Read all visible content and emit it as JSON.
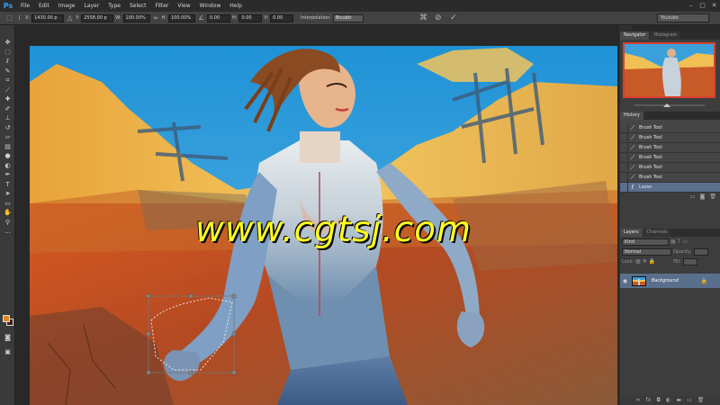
{
  "app": {
    "logo": "Ps",
    "accent": "#2fa3ff"
  },
  "menu": [
    "File",
    "Edit",
    "Image",
    "Layer",
    "Type",
    "Select",
    "Filter",
    "View",
    "Window",
    "Help"
  ],
  "window_controls": {
    "minimize": "–",
    "maximize": "▢",
    "close": "✕"
  },
  "options_bar": {
    "x_label": "X:",
    "x_value": "1430.00 p",
    "y_label": "Y:",
    "y_value": "2558.00 p",
    "w_label": "W:",
    "w_value": "100.00%",
    "h_label": "H:",
    "h_value": "100.00%",
    "angle_value": "0.00",
    "hskew_label": "H:",
    "hskew_value": "0.00",
    "vskew_label": "V:",
    "vskew_value": "0.00",
    "interpolation_label": "Interpolation:",
    "interpolation_value": "Bicubic",
    "workspace": "Youtube"
  },
  "canvas": {
    "watermark": "www.cgtsj.com"
  },
  "navigator": {
    "tabs": [
      "Navigator",
      "Histogram"
    ]
  },
  "history": {
    "tab": "History",
    "items": [
      "Brush Tool",
      "Brush Tool",
      "Brush Tool",
      "Brush Tool",
      "Brush Tool",
      "Brush Tool",
      "Lasso"
    ],
    "active_index": 6
  },
  "layers": {
    "tabs": [
      "Layers",
      "Channels"
    ],
    "filter_kind": "Kind",
    "blend_mode": "Normal",
    "opacity_label": "Opacity:",
    "lock_label": "Lock:",
    "fill_label": "Fill:",
    "layer_name": "Background"
  },
  "colors": {
    "foreground": "#e08a1e",
    "background": "#3a2010",
    "selection": "#5a6f8c",
    "watermark": "#ffff22"
  },
  "icons": [
    "move-icon",
    "marquee-icon",
    "lasso-icon",
    "quick-select-icon",
    "crop-icon",
    "eyedropper-icon",
    "healing-icon",
    "brush-icon",
    "stamp-icon",
    "history-brush-icon",
    "eraser-icon",
    "gradient-icon",
    "blur-icon",
    "dodge-icon",
    "pen-icon",
    "type-icon",
    "path-select-icon",
    "shape-icon",
    "hand-icon",
    "zoom-icon"
  ]
}
